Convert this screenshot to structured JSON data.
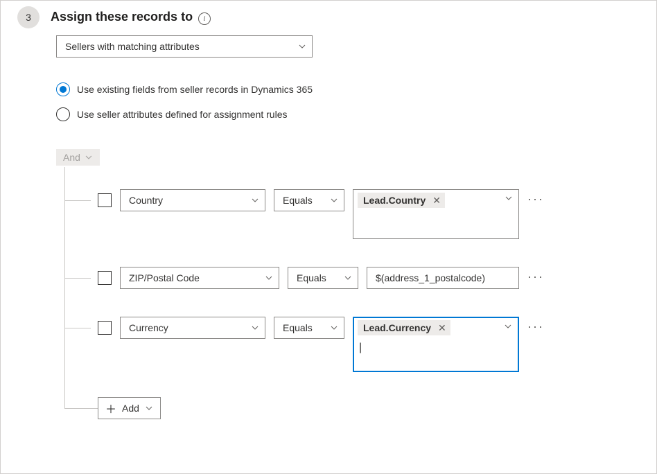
{
  "step": "3",
  "title": "Assign these records to",
  "info_tooltip": "i",
  "assign_dropdown": {
    "value": "Sellers with matching attributes"
  },
  "radios": {
    "option1": "Use existing fields from seller records in Dynamics 365",
    "option2": "Use seller attributes defined for assignment rules",
    "selected": 0
  },
  "group_operator": "And",
  "conditions": [
    {
      "field": "Country",
      "operator": "Equals",
      "value_tag": "Lead.Country",
      "value_text": ""
    },
    {
      "field": "ZIP/Postal Code",
      "operator": "Equals",
      "value_tag": "",
      "value_text": "$(address_1_postalcode)"
    },
    {
      "field": "Currency",
      "operator": "Equals",
      "value_tag": "Lead.Currency",
      "value_text": ""
    }
  ],
  "add_label": "Add",
  "more_glyph": "···",
  "clear_glyph": "✕"
}
